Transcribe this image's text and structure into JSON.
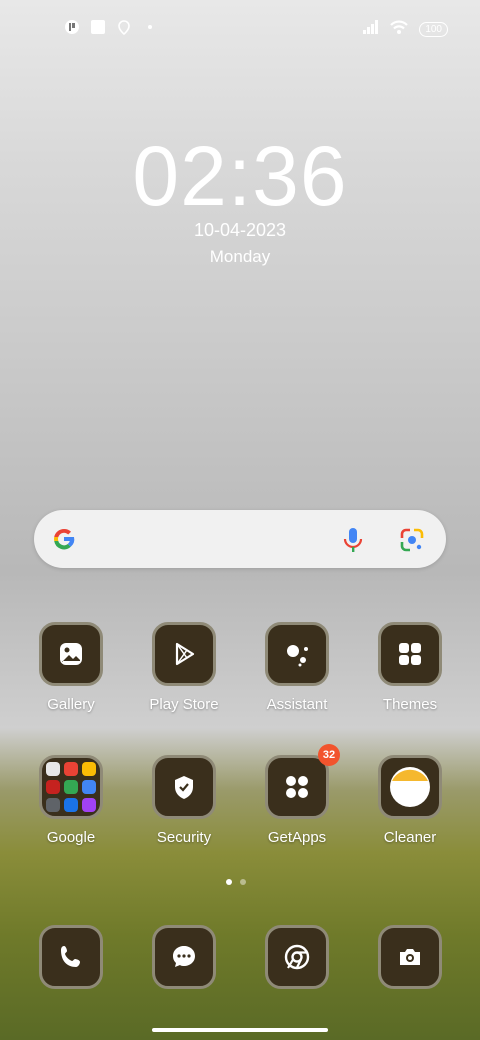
{
  "status_bar": {
    "left_icons": [
      "notification-app-icon",
      "square-notification-icon",
      "location-pin-icon",
      "small-dot-icon"
    ],
    "right_icons": [
      "signal-icon",
      "wifi-icon"
    ],
    "battery": "100"
  },
  "clock": {
    "time": "02:36",
    "date": "10-04-2023",
    "day": "Monday"
  },
  "search_bar": {
    "icons": [
      "google-g-icon",
      "microphone-icon",
      "google-lens-icon"
    ]
  },
  "apps_row1": [
    {
      "label": "Gallery",
      "icon": "gallery-icon"
    },
    {
      "label": "Play Store",
      "icon": "play-store-icon"
    },
    {
      "label": "Assistant",
      "icon": "assistant-icon"
    },
    {
      "label": "Themes",
      "icon": "themes-icon"
    }
  ],
  "apps_row2": [
    {
      "label": "Google",
      "icon": "folder-icon"
    },
    {
      "label": "Security",
      "icon": "security-shield-icon"
    },
    {
      "label": "GetApps",
      "icon": "getapps-icon",
      "badge": "32"
    },
    {
      "label": "Cleaner",
      "icon": "cleaner-icon"
    }
  ],
  "dock": [
    {
      "icon": "phone-icon"
    },
    {
      "icon": "messages-icon"
    },
    {
      "icon": "chrome-icon"
    },
    {
      "icon": "camera-icon"
    }
  ],
  "page_indicator": {
    "pages": 2,
    "current": 1
  },
  "colors": {
    "tile_bg": "#3a2f1c",
    "tile_border": "#8f8a77",
    "badge": "#f2542d"
  }
}
